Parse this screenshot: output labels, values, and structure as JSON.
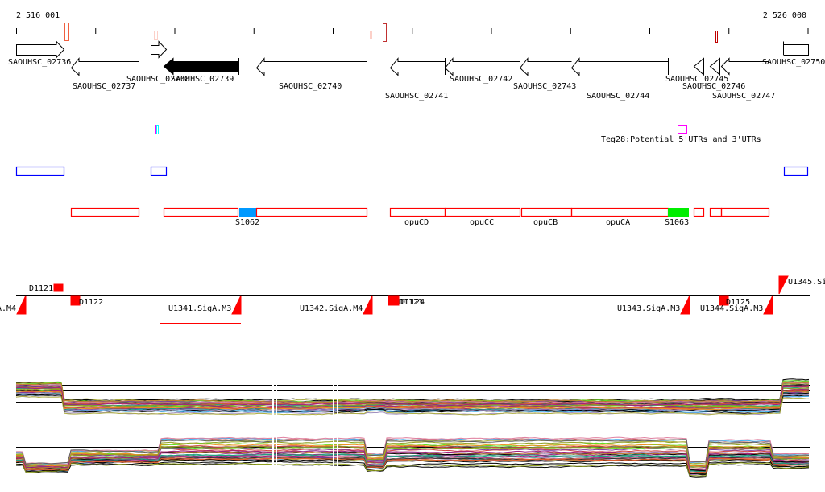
{
  "ruler": {
    "start_label": "2 516 001",
    "end_label": "2 526 000"
  },
  "genes": {
    "g02736": "SAOUHSC_02736",
    "g02737": "SAOUHSC_02737",
    "g02738": "SAOUHSC_02738",
    "g02739": "SAOUHSC_02739",
    "g02740": "SAOUHSC_02740",
    "g02741": "SAOUHSC_02741",
    "g02742": "SAOUHSC_02742",
    "g02743": "SAOUHSC_02743",
    "g02744": "SAOUHSC_02744",
    "g02745": "SAOUHSC_02745",
    "g02746": "SAOUHSC_02746",
    "g02747": "SAOUHSC_02747",
    "g02750": "SAOUHSC_02750"
  },
  "utr_track": {
    "label": "Teg28:Potential 5'UTRs and 3'UTRs"
  },
  "operon_track": {
    "labels": [
      "S1062",
      "opuCD",
      "opuCC",
      "opuCB",
      "opuCA",
      "S1063"
    ],
    "colors": {
      "S1062": "#0099ff",
      "S1063": "#00ee00"
    }
  },
  "promoter_track": {
    "labels": [
      "D1121",
      "D1122",
      "A.M4",
      "U1341.SigA.M3",
      "U1342.SigA.M4",
      "D1123",
      "D1124",
      "U1343.SigA.M3",
      "U1344.SigA.M3",
      "D1125",
      "U1345.Si"
    ]
  }
}
